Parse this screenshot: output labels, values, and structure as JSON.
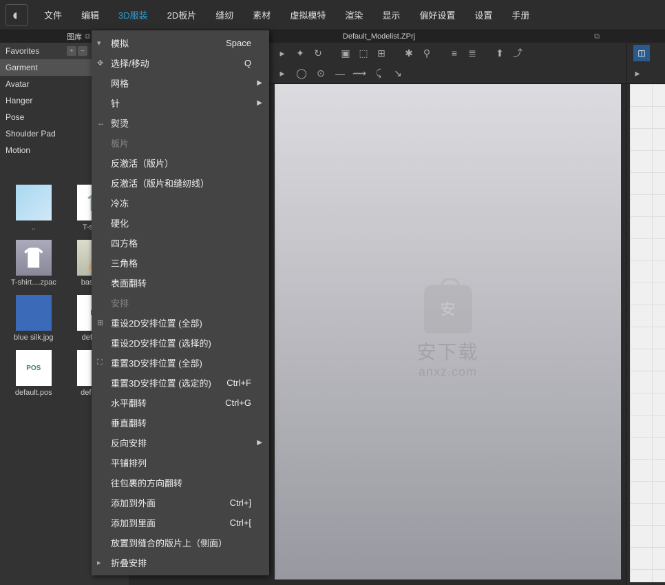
{
  "menubar": {
    "items": [
      "文件",
      "编辑",
      "3D服装",
      "2D板片",
      "缝纫",
      "素材",
      "虚拟模特",
      "渲染",
      "显示",
      "偏好设置",
      "设置",
      "手册"
    ],
    "active_index": 2
  },
  "secondary_bar": {
    "left_label": "图库",
    "center_title": "Default_Modelist.ZPrj"
  },
  "sidebar": {
    "favorites_label": "Favorites",
    "items": [
      "Garment",
      "Avatar",
      "Hanger",
      "Pose",
      "Shoulder Pad",
      "Motion"
    ],
    "selected_index": 0
  },
  "library": {
    "items": [
      {
        "label": "..",
        "kind": "folder"
      },
      {
        "label": "T-shirt..",
        "kind": "shirt"
      },
      {
        "label": "T-shirt....zpac",
        "kind": "shirt2"
      },
      {
        "label": "basic_...",
        "kind": "legs"
      },
      {
        "label": "blue silk.jpg",
        "kind": "blue"
      },
      {
        "label": "defaul...",
        "kind": "pa",
        "text": "PA"
      },
      {
        "label": "default.pos",
        "kind": "pos",
        "text": "POS"
      },
      {
        "label": "default...",
        "kind": "red"
      }
    ]
  },
  "dropdown": {
    "rows": [
      {
        "label": "模拟",
        "shortcut": "Space",
        "icon": "▾"
      },
      {
        "label": "选择/移动",
        "shortcut": "Q",
        "icon": "✥"
      },
      {
        "label": "网格",
        "submenu": true
      },
      {
        "label": "针",
        "submenu": true
      },
      {
        "label": "熨烫",
        "icon": "↔"
      },
      {
        "label": "板片",
        "disabled": true
      },
      {
        "label": "反激活（版片）"
      },
      {
        "label": "反激活（版片和缝纫线）"
      },
      {
        "label": "冷冻"
      },
      {
        "label": "硬化"
      },
      {
        "label": "四方格"
      },
      {
        "label": "三角格"
      },
      {
        "label": "表面翻转"
      },
      {
        "label": "安排",
        "disabled": true
      },
      {
        "label": "重设2D安排位置 (全部)",
        "icon": "⊞"
      },
      {
        "label": "重设2D安排位置 (选择的)"
      },
      {
        "label": "重置3D安排位置 (全部)",
        "icon": "⛶"
      },
      {
        "label": "重置3D安排位置 (选定的)",
        "shortcut": "Ctrl+F"
      },
      {
        "label": "水平翻转",
        "shortcut": "Ctrl+G"
      },
      {
        "label": "垂直翻转"
      },
      {
        "label": "反向安排",
        "submenu": true
      },
      {
        "label": "平铺排列"
      },
      {
        "label": "往包裹的方向翻转"
      },
      {
        "label": "添加到外面",
        "shortcut": "Ctrl+]"
      },
      {
        "label": "添加到里面",
        "shortcut": "Ctrl+["
      },
      {
        "label": "放置到缝合的版片上（侧面）"
      },
      {
        "label": "折叠安排",
        "icon": "▸"
      }
    ]
  },
  "watermark": {
    "line1": "安下载",
    "line2": "anxz.com"
  }
}
